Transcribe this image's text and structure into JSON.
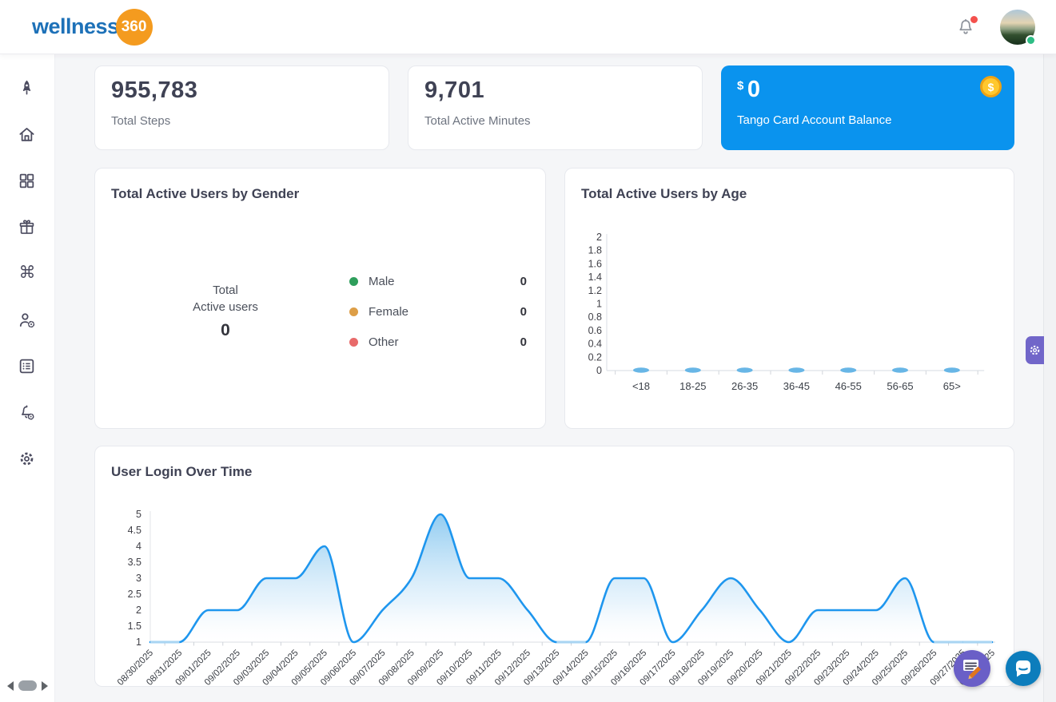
{
  "header": {
    "logo": {
      "text": "wellness",
      "badge": "360"
    },
    "notifications": {
      "icon": "bell-icon",
      "has_unread": true
    },
    "avatar": {
      "icon": "user-avatar",
      "status": "online"
    }
  },
  "sidebar": {
    "items": [
      {
        "icon": "rocket-icon"
      },
      {
        "icon": "home-icon"
      },
      {
        "icon": "dashboard-grid-icon"
      },
      {
        "icon": "gift-icon"
      },
      {
        "icon": "command-icon"
      },
      {
        "icon": "user-settings-icon"
      },
      {
        "icon": "list-icon"
      },
      {
        "icon": "notification-settings-icon"
      },
      {
        "icon": "settings-icon"
      }
    ]
  },
  "stats": [
    {
      "value": "955,783",
      "label": "Total Steps"
    },
    {
      "value": "9,701",
      "label": "Total Active Minutes"
    },
    {
      "currency": "$",
      "value": "0",
      "label": "Tango Card Account Balance",
      "icon": "coin-icon",
      "accent": "#0a93ee"
    }
  ],
  "chart_data": [
    {
      "id": "gender",
      "type": "donut",
      "title": "Total Active Users by Gender",
      "center_label_1": "Total",
      "center_label_2": "Active users",
      "center_value": "0",
      "legend_position": "right",
      "legend": [
        {
          "label": "Male",
          "value": "0",
          "color": "#2e9e5b"
        },
        {
          "label": "Female",
          "value": "0",
          "color": "#dd9e47"
        },
        {
          "label": "Other",
          "value": "0",
          "color": "#e86a6a"
        }
      ]
    },
    {
      "id": "age",
      "type": "bar",
      "title": "Total Active Users by Age",
      "categories": [
        "<18",
        "18-25",
        "26-35",
        "36-45",
        "46-55",
        "56-65",
        "65>"
      ],
      "values": [
        0,
        0,
        0,
        0,
        0,
        0,
        0
      ],
      "ylim": [
        0,
        2
      ],
      "y_step": 0.2,
      "bar_color": "#68b6e6",
      "grid": false
    },
    {
      "id": "login",
      "type": "area",
      "title": "User Login Over Time",
      "x": [
        "08/30/2025",
        "08/31/2025",
        "09/01/2025",
        "09/02/2025",
        "09/03/2025",
        "09/04/2025",
        "09/05/2025",
        "09/06/2025",
        "09/07/2025",
        "09/08/2025",
        "09/09/2025",
        "09/10/2025",
        "09/11/2025",
        "09/12/2025",
        "09/13/2025",
        "09/14/2025",
        "09/15/2025",
        "09/16/2025",
        "09/17/2025",
        "09/18/2025",
        "09/19/2025",
        "09/20/2025",
        "09/21/2025",
        "09/22/2025",
        "09/23/2025",
        "09/24/2025",
        "09/25/2025",
        "09/26/2025",
        "09/27/2025",
        "09/28/2025"
      ],
      "values": [
        1,
        1,
        2,
        2,
        3,
        3,
        4,
        1,
        2,
        3,
        5,
        3,
        3,
        2,
        1,
        1,
        3,
        3,
        1,
        2,
        3,
        2,
        1,
        2,
        2,
        2,
        3,
        1,
        1,
        1
      ],
      "ylim": [
        1,
        5
      ],
      "y_step": 0.5,
      "line_color": "#1e96ee",
      "muted_line_color": "#aad5f2",
      "area_top_color": "#8bc9f0",
      "grid": false
    }
  ],
  "floating": {
    "settings_tab_icon": "gear-icon",
    "survey_button_icon": "survey-pencil-icon",
    "chat_button_icon": "chat-bubble-icon"
  },
  "colors": {
    "accent_blue": "#0a93ee",
    "logo_blue": "#1d71b8",
    "logo_orange": "#f49b1f",
    "purple": "#6a5fc7",
    "chat_blue": "#0d7dbc",
    "page_bg": "#f5f6f8"
  }
}
